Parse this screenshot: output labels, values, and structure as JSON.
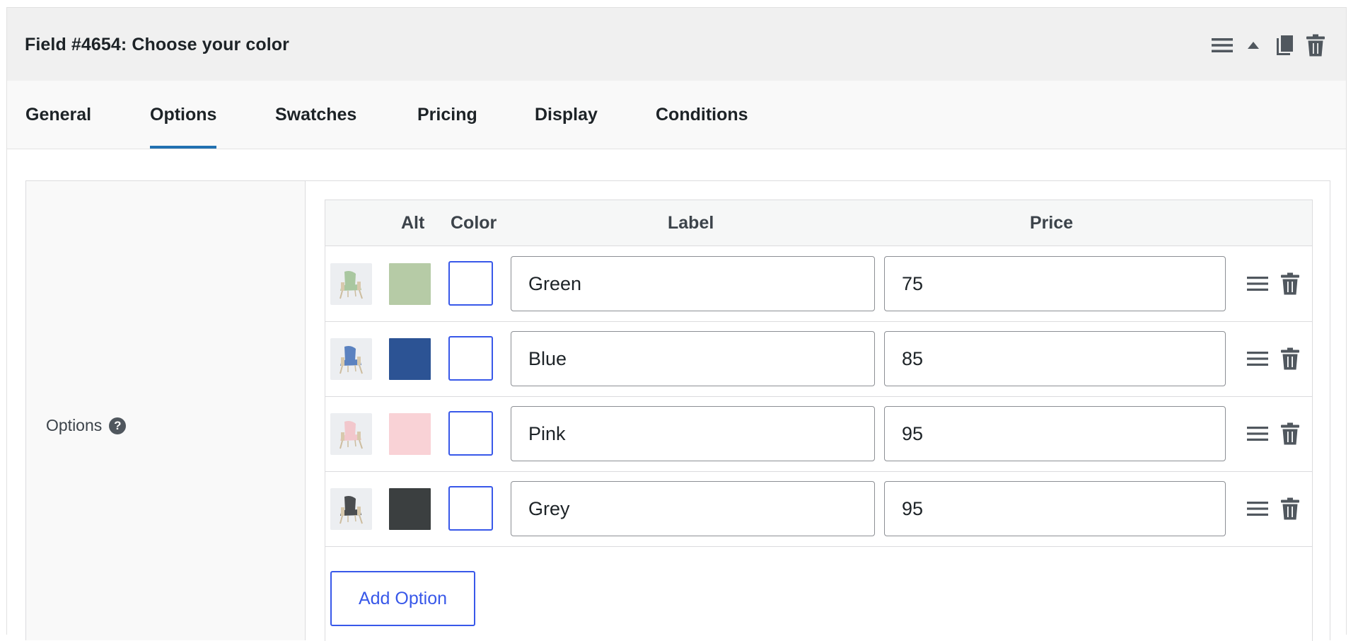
{
  "header": {
    "title": "Field #4654: Choose your color",
    "icons": [
      "menu-icon",
      "caret-up-icon",
      "duplicate-icon",
      "trash-icon"
    ]
  },
  "tabs": [
    {
      "label": "General",
      "active": false
    },
    {
      "label": "Options",
      "active": true
    },
    {
      "label": "Swatches",
      "active": false
    },
    {
      "label": "Pricing",
      "active": false
    },
    {
      "label": "Display",
      "active": false
    },
    {
      "label": "Conditions",
      "active": false
    }
  ],
  "section": {
    "label": "Options",
    "help_glyph": "?"
  },
  "table": {
    "headers": {
      "alt": "Alt",
      "color": "Color",
      "label": "Label",
      "price": "Price"
    },
    "rows": [
      {
        "label": "Green",
        "price": "75",
        "swatch_color": "#b6cba6",
        "chair_color": "#a9c7a0"
      },
      {
        "label": "Blue",
        "price": "85",
        "swatch_color": "#2c5394",
        "chair_color": "#5b82c0"
      },
      {
        "label": "Pink",
        "price": "95",
        "swatch_color": "#f9d2d6",
        "chair_color": "#f2c7cc"
      },
      {
        "label": "Grey",
        "price": "95",
        "swatch_color": "#3b3f40",
        "chair_color": "#4a4d50"
      }
    ]
  },
  "add_button": {
    "label": "Add Option"
  },
  "colors": {
    "accent": "#3858e9",
    "tab_underline": "#2271b1"
  }
}
